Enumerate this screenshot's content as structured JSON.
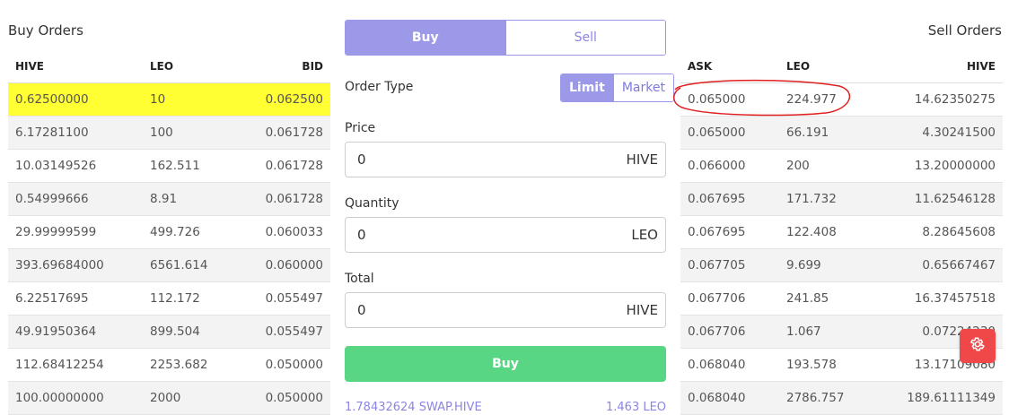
{
  "buy_orders": {
    "title": "Buy Orders",
    "headers": [
      "HIVE",
      "LEO",
      "BID"
    ],
    "rows": [
      [
        "0.62500000",
        "10",
        "0.062500"
      ],
      [
        "6.17281100",
        "100",
        "0.061728"
      ],
      [
        "10.03149526",
        "162.511",
        "0.061728"
      ],
      [
        "0.54999666",
        "8.91",
        "0.061728"
      ],
      [
        "29.99999599",
        "499.726",
        "0.060033"
      ],
      [
        "393.69684000",
        "6561.614",
        "0.060000"
      ],
      [
        "6.22517695",
        "112.172",
        "0.055497"
      ],
      [
        "49.91950364",
        "899.504",
        "0.055497"
      ],
      [
        "112.68412254",
        "2253.682",
        "0.050000"
      ],
      [
        "100.00000000",
        "2000",
        "0.050000"
      ]
    ],
    "highlight_color": "#ffff33"
  },
  "sell_orders": {
    "title": "Sell Orders",
    "headers": [
      "ASK",
      "LEO",
      "HIVE"
    ],
    "rows": [
      [
        "0.065000",
        "224.977",
        "14.62350275"
      ],
      [
        "0.065000",
        "66.191",
        "4.30241500"
      ],
      [
        "0.066000",
        "200",
        "13.20000000"
      ],
      [
        "0.067695",
        "171.732",
        "11.62546128"
      ],
      [
        "0.067695",
        "122.408",
        "8.28645608"
      ],
      [
        "0.067705",
        "9.699",
        "0.65667467"
      ],
      [
        "0.067706",
        "241.85",
        "16.37457518"
      ],
      [
        "0.067706",
        "1.067",
        "0.07224230"
      ],
      [
        "0.068040",
        "193.578",
        "13.17109080"
      ],
      [
        "0.068040",
        "2786.757",
        "189.61111349"
      ]
    ],
    "annotation_color": "#e02020"
  },
  "trade_form": {
    "tabs": {
      "buy": "Buy",
      "sell": "Sell"
    },
    "order_type_label": "Order Type",
    "order_type_options": {
      "limit": "Limit",
      "market": "Market"
    },
    "price": {
      "label": "Price",
      "value": "0",
      "unit": "HIVE"
    },
    "quantity": {
      "label": "Quantity",
      "value": "0",
      "unit": "LEO"
    },
    "total": {
      "label": "Total",
      "value": "0",
      "unit": "HIVE"
    },
    "submit_label": "Buy",
    "balance_left": "1.78432624 SWAP.HIVE",
    "balance_right": "1.463 LEO"
  },
  "colors": {
    "accent": "#9d99e9",
    "buy_button": "#58d684",
    "settings_button": "#f04848"
  },
  "icons": {
    "settings": "gear-icon"
  }
}
